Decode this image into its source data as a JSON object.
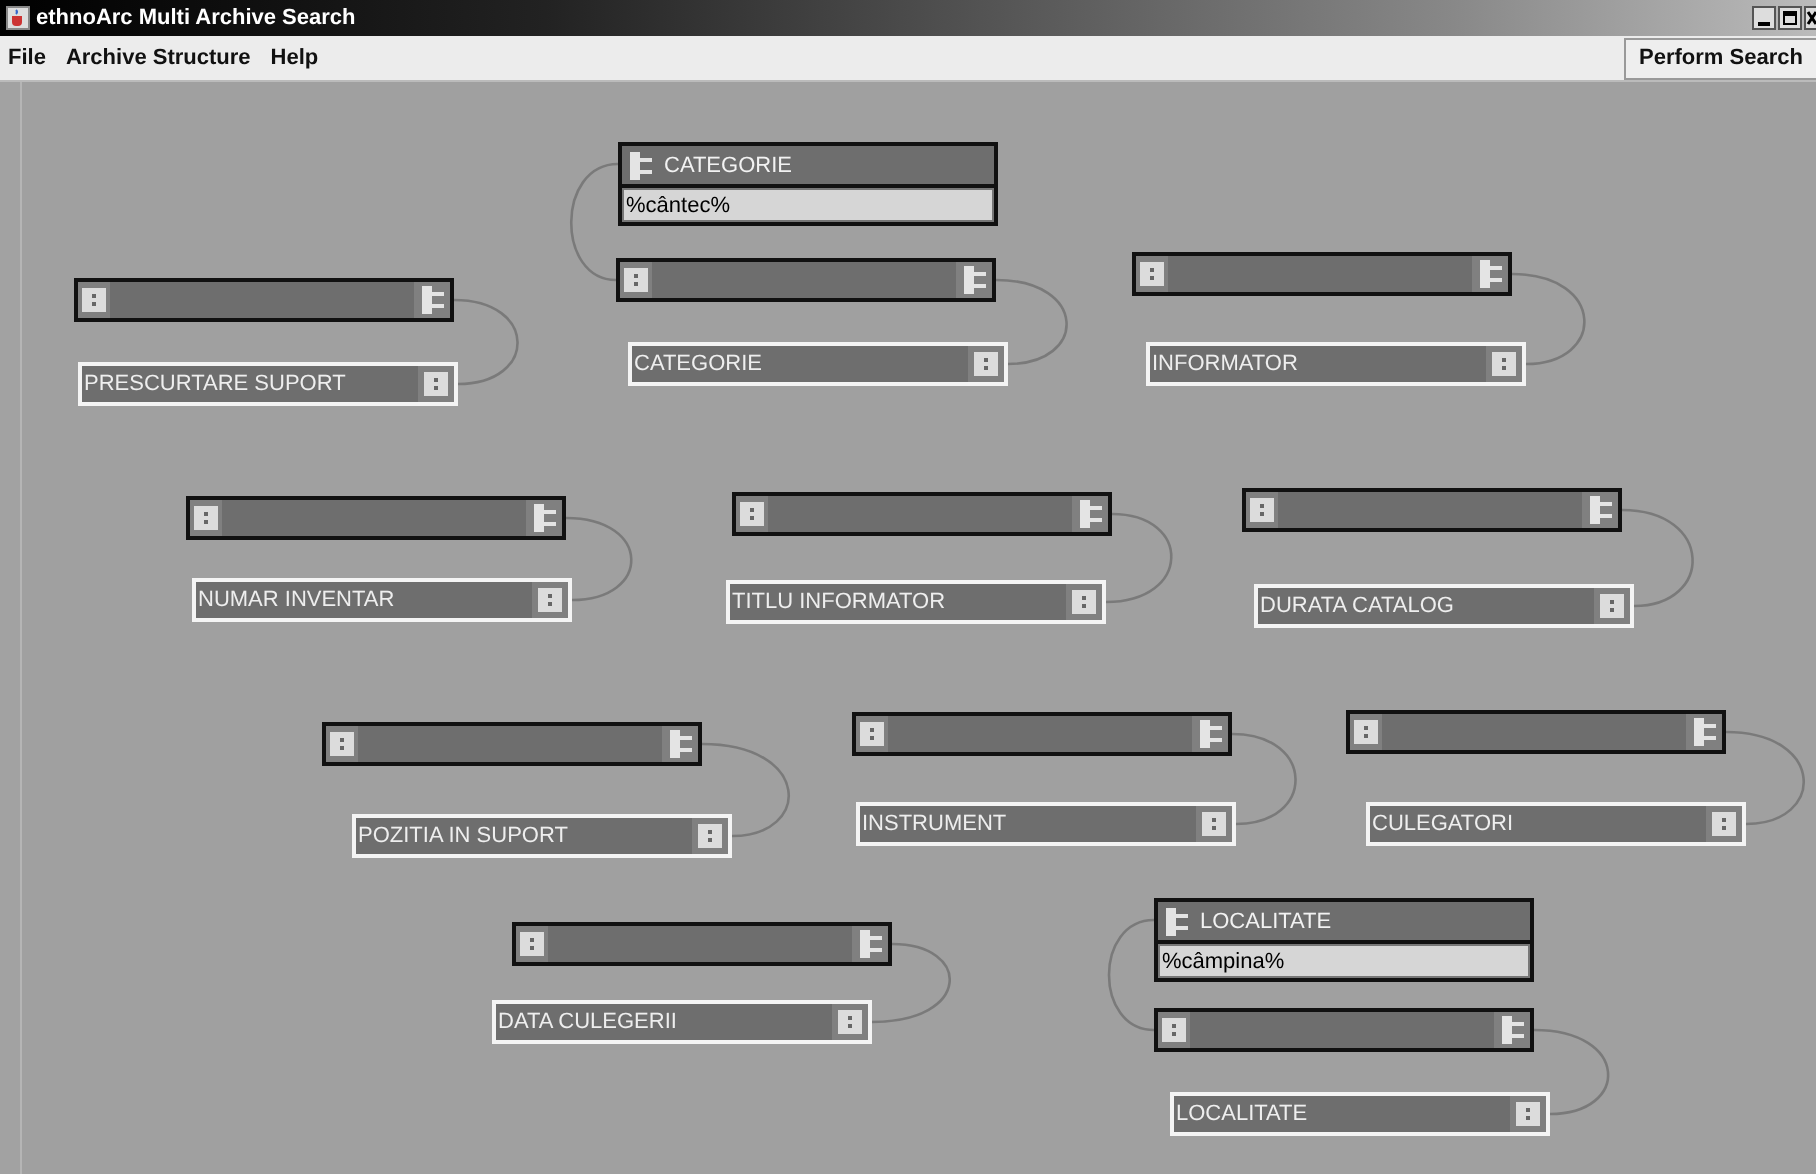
{
  "window": {
    "title": "ethnoArc Multi Archive Search"
  },
  "menu": [
    "File",
    "Archive Structure",
    "Help"
  ],
  "toolbar": {
    "search_button": "Perform Search"
  },
  "links": [
    {
      "field": "PRESCURTARE SUPORT"
    },
    {
      "field": "CATEGORIE",
      "filter": {
        "label": "CATEGORIE",
        "value": "%cântec%"
      }
    },
    {
      "field": "INFORMATOR"
    },
    {
      "field": "NUMAR INVENTAR"
    },
    {
      "field": "TITLU INFORMATOR"
    },
    {
      "field": "DURATA CATALOG"
    },
    {
      "field": "POZITIA IN SUPORT"
    },
    {
      "field": "INSTRUMENT"
    },
    {
      "field": "CULEGATORI"
    },
    {
      "field": "DATA CULEGERII"
    },
    {
      "field": "LOCALITATE",
      "filter": {
        "label": "LOCALITATE",
        "value": "%câmpina%"
      }
    }
  ]
}
